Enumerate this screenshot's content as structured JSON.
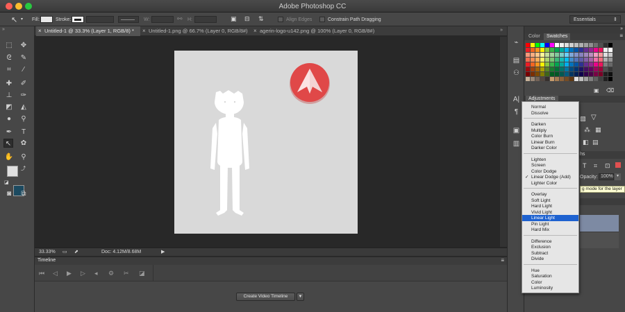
{
  "window": {
    "title": "Adobe Photoshop CC"
  },
  "options": {
    "fill_label": "Fill:",
    "stroke_label": "Stroke:",
    "w_label": "W:",
    "h_label": "H:",
    "align_edges": "Align Edges",
    "constrain": "Constrain Path Dragging",
    "workspace": "Essentials"
  },
  "tabs": [
    {
      "label": "Untitled-1 @ 33.3% (Layer 1, RGB/8) *",
      "active": true
    },
    {
      "label": "Untitled-1.png @ 66.7% (Layer 0, RGB/8#)",
      "active": false
    },
    {
      "label": "agerin-logo-u142.png @ 100% (Layer 0, RGB/8#)",
      "active": false
    }
  ],
  "status": {
    "zoom": "33.33%",
    "doc": "Doc: 4.12M/8.68M"
  },
  "timeline": {
    "title": "Timeline",
    "create_button": "Create Video Timeline"
  },
  "panels": {
    "color_tab": "Color",
    "swatches_tab": "Swatches",
    "adjustments_tab": "Adjustments",
    "paths_tab_fragment": "hs",
    "opacity_label": "Opacity:",
    "opacity_value": "100%"
  },
  "blend_modes": {
    "groups": [
      [
        "Normal",
        "Dissolve"
      ],
      [
        "Darken",
        "Multiply",
        "Color Burn",
        "Linear Burn",
        "Darker Color"
      ],
      [
        "Lighten",
        "Screen",
        "Color Dodge",
        "Linear Dodge (Add)",
        "Lighter Color"
      ],
      [
        "Overlay",
        "Soft Light",
        "Hard Light",
        "Vivid Light",
        "Linear Light",
        "Pin Light",
        "Hard Mix"
      ],
      [
        "Difference",
        "Exclusion",
        "Subtract",
        "Divide"
      ],
      [
        "Hue",
        "Saturation",
        "Color",
        "Luminosity"
      ]
    ],
    "checked": "Linear Dodge (Add)",
    "highlighted": "Linear Light"
  },
  "tooltip": "g mode for the layer",
  "colors": {
    "logo_red": "#e04848",
    "foreground": "#e0e0e0",
    "background": "#1c4a60",
    "highlight": "#1e62d0"
  }
}
